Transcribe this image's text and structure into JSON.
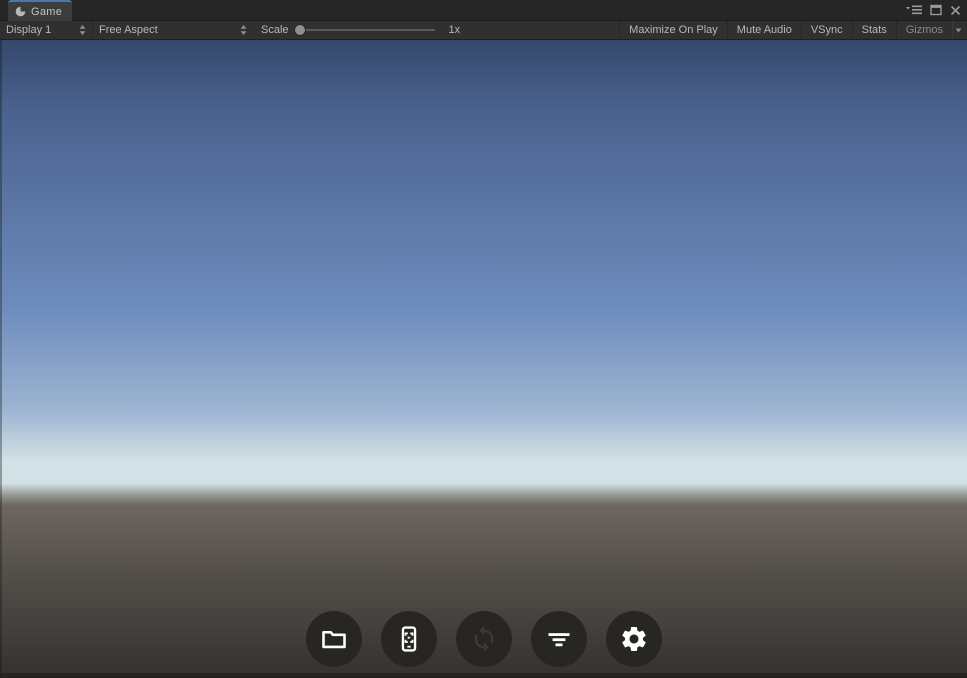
{
  "window": {
    "tab": {
      "label": "Game",
      "icon": "game-view-icon"
    },
    "controls": {
      "menu": "window-menu-icon",
      "maximize": "maximize-icon",
      "close": "close-icon"
    }
  },
  "toolbar": {
    "display_dropdown": {
      "label": "Display 1"
    },
    "aspect_dropdown": {
      "label": "Free Aspect"
    },
    "scale": {
      "label": "Scale",
      "value": "1x",
      "slider_position": 0
    },
    "buttons": [
      {
        "label": "Maximize On Play",
        "enabled": true
      },
      {
        "label": "Mute Audio",
        "enabled": true
      },
      {
        "label": "VSync",
        "enabled": true
      },
      {
        "label": "Stats",
        "enabled": true
      },
      {
        "label": "Gizmos",
        "enabled": false,
        "has_dropdown": true
      }
    ]
  },
  "viewport": {
    "scene": "empty 3D scene with gradient sky over flat ground plane, horizon near lower third"
  },
  "action_bar": {
    "buttons": [
      {
        "name": "folder",
        "icon": "folder-icon",
        "enabled": true
      },
      {
        "name": "device-scan",
        "icon": "device-scan-icon",
        "enabled": true
      },
      {
        "name": "refresh",
        "icon": "refresh-icon",
        "enabled": false
      },
      {
        "name": "filter",
        "icon": "filter-icon",
        "enabled": true
      },
      {
        "name": "settings",
        "icon": "gear-icon",
        "enabled": true
      }
    ]
  },
  "colors": {
    "tab_accent": "#4a77a8",
    "sky_top": "#35486c",
    "sky_upper": "#49608c",
    "sky_mid": "#6d8cbd",
    "sky_low": "#9db4d2",
    "horizon_glow": "#d2e1e5",
    "fog": "#9a9c98",
    "ground_near": "#6c665f",
    "ground_mid": "#55504a",
    "ground_far": "#343130",
    "button_circle": "#282623",
    "icon_enabled": "#ffffff",
    "icon_disabled": "#3d3a36"
  }
}
